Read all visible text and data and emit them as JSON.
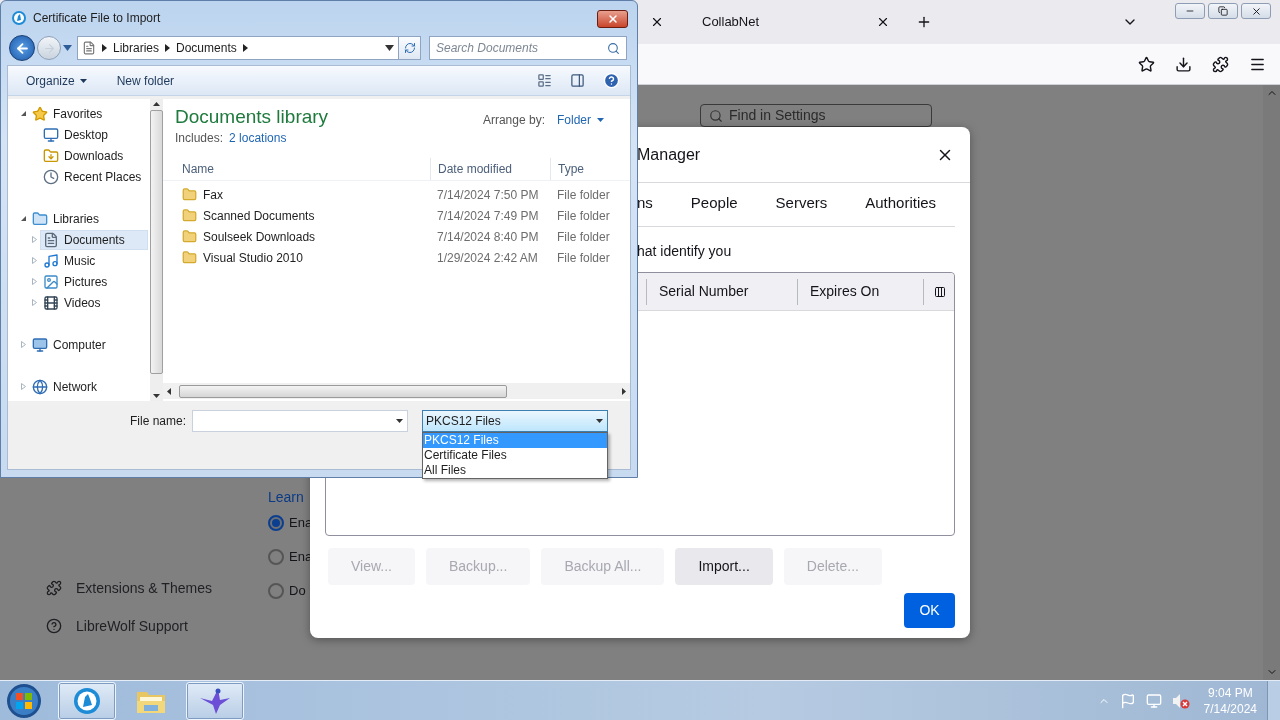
{
  "browser": {
    "tabs": [
      {
        "label": "CollabNet",
        "selected": false
      }
    ],
    "settings": {
      "search": {
        "placeholder": "Find in Settings"
      },
      "learn_link": "Learn",
      "radios": [
        {
          "label": "Ena",
          "selected": true
        },
        {
          "label": "Ena",
          "selected": false
        },
        {
          "label": "Do",
          "selected": false
        }
      ],
      "sidebar": [
        {
          "label": "Extensions & Themes",
          "kind": "puzzle"
        },
        {
          "label": "LibreWolf Support",
          "kind": "help"
        }
      ]
    }
  },
  "cert_manager": {
    "title": "Manager",
    "tabs": [
      {
        "label": "ns",
        "selected": false
      },
      {
        "label": "People",
        "selected": false
      },
      {
        "label": "Servers",
        "selected": false
      },
      {
        "label": "Authorities",
        "selected": false
      }
    ],
    "description": "hat identify you",
    "columns": [
      "Serial Number",
      "Expires On"
    ],
    "buttons": [
      {
        "label": "View...",
        "disabled": true
      },
      {
        "label": "Backup...",
        "disabled": true
      },
      {
        "label": "Backup All...",
        "disabled": true
      },
      {
        "label": "Import...",
        "disabled": false
      },
      {
        "label": "Delete...",
        "disabled": true
      }
    ],
    "ok": "OK"
  },
  "file_dialog": {
    "title": "Certificate File to Import",
    "breadcrumb": [
      "Libraries",
      "Documents"
    ],
    "search": {
      "placeholder": "Search Documents"
    },
    "toolbar": {
      "organize": "Organize",
      "new_folder": "New folder"
    },
    "nav_tree": [
      {
        "label": "Favorites",
        "kind": "star",
        "expanded": true,
        "selected": false,
        "children": [
          {
            "label": "Desktop",
            "kind": "desktop",
            "selected": false
          },
          {
            "label": "Downloads",
            "kind": "downloads",
            "selected": false
          },
          {
            "label": "Recent Places",
            "kind": "recent",
            "selected": false
          }
        ]
      },
      {
        "label": "Libraries",
        "kind": "library",
        "expanded": true,
        "selected": false,
        "children": [
          {
            "label": "Documents",
            "kind": "documents",
            "expanded": false,
            "selected": true
          },
          {
            "label": "Music",
            "kind": "music",
            "expanded": false,
            "selected": false
          },
          {
            "label": "Pictures",
            "kind": "pictures",
            "expanded": false,
            "selected": false
          },
          {
            "label": "Videos",
            "kind": "videos",
            "expanded": false,
            "selected": false
          }
        ]
      },
      {
        "label": "Computer",
        "kind": "computer",
        "expanded": false,
        "selected": false
      },
      {
        "label": "Network",
        "kind": "network",
        "expanded": false,
        "selected": false
      }
    ],
    "library": {
      "title": "Documents library",
      "includes_label": "Includes:",
      "includes_link": "2 locations",
      "arrange_label": "Arrange by:",
      "arrange_value": "Folder"
    },
    "columns": [
      "Name",
      "Date modified",
      "Type"
    ],
    "files": [
      {
        "name": "Fax",
        "date": "7/14/2024 7:50 PM",
        "type": "File folder"
      },
      {
        "name": "Scanned Documents",
        "date": "7/14/2024 7:49 PM",
        "type": "File folder"
      },
      {
        "name": "Soulseek Downloads",
        "date": "7/14/2024 8:40 PM",
        "type": "File folder"
      },
      {
        "name": "Visual Studio 2010",
        "date": "1/29/2024 2:42 AM",
        "type": "File folder"
      }
    ],
    "file_name": {
      "label": "File name:"
    },
    "file_type": {
      "value": "PKCS12 Files",
      "options": [
        {
          "label": "PKCS12 Files",
          "selected": true
        },
        {
          "label": "Certificate Files",
          "selected": false
        },
        {
          "label": "All Files",
          "selected": false
        }
      ]
    }
  },
  "taskbar": {
    "apps": [
      {
        "kind": "librewolf",
        "open": true
      },
      {
        "kind": "explorer",
        "open": false
      },
      {
        "kind": "bird",
        "open": true
      }
    ],
    "time": "9:04 PM",
    "date": "7/14/2024"
  }
}
